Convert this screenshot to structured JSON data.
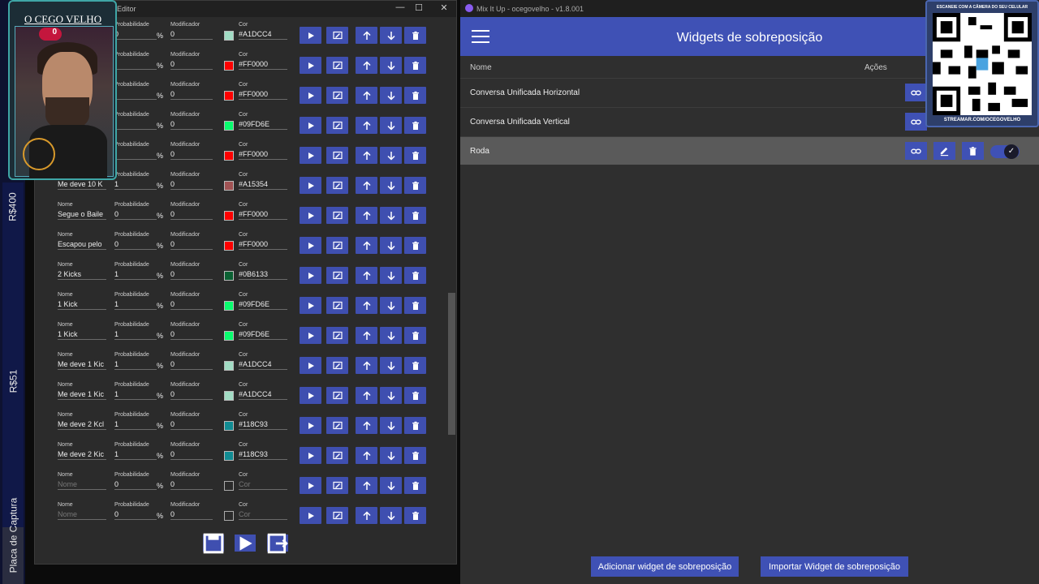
{
  "stream": {
    "labels": [
      "R$400",
      "R$51",
      "Placa de Captura"
    ]
  },
  "avatar": {
    "name": "O CEGO VELHO",
    "badge": "0"
  },
  "editor": {
    "title": "sição - Editor",
    "field_labels": {
      "name": "Nome",
      "probability": "Probabilidade",
      "modifier": "Modificador",
      "color": "Cor",
      "percent": "%"
    },
    "rows": [
      {
        "name": "",
        "prob": "0",
        "mod": "0",
        "color": "#A1DCC4"
      },
      {
        "name": "",
        "prob": "",
        "mod": "0",
        "color": "#FF0000"
      },
      {
        "name": "",
        "prob": "",
        "mod": "0",
        "color": "#FF0000"
      },
      {
        "name": "",
        "prob": "",
        "mod": "0",
        "color": "#09FD6E"
      },
      {
        "name": "",
        "prob": "",
        "mod": "0",
        "color": "#FF0000"
      },
      {
        "name": "Me deve 10 K",
        "prob": "1",
        "mod": "0",
        "color": "#A15354"
      },
      {
        "name": "Segue o Baile",
        "prob": "0",
        "mod": "0",
        "color": "#FF0000"
      },
      {
        "name": "Escapou pelo",
        "prob": "0",
        "mod": "0",
        "color": "#FF0000"
      },
      {
        "name": "2 Kicks",
        "prob": "1",
        "mod": "0",
        "color": "#0B6133"
      },
      {
        "name": "1 Kick",
        "prob": "1",
        "mod": "0",
        "color": "#09FD6E"
      },
      {
        "name": "1 Kick",
        "prob": "1",
        "mod": "0",
        "color": "#09FD6E"
      },
      {
        "name": "Me deve 1 Kic",
        "prob": "1",
        "mod": "0",
        "color": "#A1DCC4"
      },
      {
        "name": "Me deve 1 Kic",
        "prob": "1",
        "mod": "0",
        "color": "#A1DCC4"
      },
      {
        "name": "Me deve 2 Kcl",
        "prob": "1",
        "mod": "0",
        "color": "#118C93"
      },
      {
        "name": "Me deve 2 Kic",
        "prob": "1",
        "mod": "0",
        "color": "#118C93"
      },
      {
        "name": "",
        "prob": "0",
        "mod": "0",
        "color": ""
      },
      {
        "name": "",
        "prob": "0",
        "mod": "0",
        "color": ""
      }
    ]
  },
  "mixitup": {
    "window_title": "Mix It Up - ocegovelho - v1.8.001",
    "header_title": "Widgets de sobreposição",
    "columns": {
      "name": "Nome",
      "actions": "Ações"
    },
    "widgets": [
      {
        "name": "Conversa Unificada Horizontal"
      },
      {
        "name": "Conversa Unificada Vertical"
      },
      {
        "name": "Roda"
      }
    ],
    "add_button": "Adicionar widget de sobreposição",
    "import_button": "Importar Widget de sobreposição",
    "accent": "#3f51b5"
  },
  "qr": {
    "header": "ESCANEIE COM A CÂMERA DO SEU CELULAR",
    "footer": "STREAMAR.COM/OCEGOVELHO"
  }
}
